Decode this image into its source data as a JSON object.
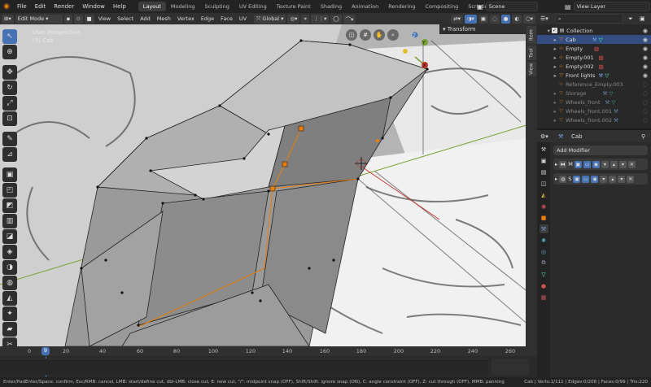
{
  "topbar": {
    "menus": [
      "File",
      "Edit",
      "Render",
      "Window",
      "Help"
    ],
    "workspaces": [
      "Layout",
      "Modeling",
      "Sculpting",
      "UV Editing",
      "Texture Paint",
      "Shading",
      "Animation",
      "Rendering",
      "Compositing",
      "Scripting"
    ],
    "active_workspace": "Layout",
    "add_workspace": "+",
    "scene": "Scene",
    "view_layer": "View Layer"
  },
  "header": {
    "mode": "Edit Mode",
    "menus": [
      "View",
      "Select",
      "Add",
      "Mesh",
      "Vertex",
      "Edge",
      "Face",
      "UV"
    ],
    "orientation": "Global"
  },
  "viewport": {
    "view_label": "User Perspective",
    "object_label": "(9) Cab",
    "gizmo_axes": [
      "Y",
      "Z",
      "X"
    ]
  },
  "npanel": {
    "title": "Transform",
    "tabs": [
      "Item",
      "Tool",
      "View"
    ]
  },
  "timeline": {
    "ticks": [
      "0",
      "9",
      "20",
      "40",
      "60",
      "80",
      "100",
      "120",
      "140",
      "160",
      "180",
      "200",
      "220",
      "240",
      "260"
    ],
    "current_frame": "9"
  },
  "status": {
    "hint": "Enter/PadEnter/Space: confirm, Esc/RMB: cancel, LMB: start/define cut, dbl-LMB: close cut, E: new cut, \"/\": midpoint snap (OFF), Shift/Shift: ignore snap (ON), C: angle constraint (OFF), Z: cut through (OFF), MMB: panning",
    "stats": "Cab | Verts:1/111 | Edges:0/208 | Faces:0/99 | Tris:220"
  },
  "outliner": {
    "collection": "Collection",
    "items": [
      {
        "name": "Cab",
        "selected": true,
        "dim": false
      },
      {
        "name": "Empty",
        "selected": false,
        "dim": false
      },
      {
        "name": "Empty.001",
        "selected": false,
        "dim": false
      },
      {
        "name": "Empty.002",
        "selected": false,
        "dim": false
      },
      {
        "name": "Front lights",
        "selected": false,
        "dim": false
      },
      {
        "name": "Reference_Empty.003",
        "selected": false,
        "dim": true
      },
      {
        "name": "Storage",
        "selected": false,
        "dim": true
      },
      {
        "name": "Wheels_front",
        "selected": false,
        "dim": true
      },
      {
        "name": "Wheels_front.001",
        "selected": false,
        "dim": true
      },
      {
        "name": "Wheels_front.002",
        "selected": false,
        "dim": true
      }
    ]
  },
  "properties": {
    "object_name": "Cab",
    "add_modifier": "Add Modifier",
    "modifiers": [
      {
        "letter": "M"
      },
      {
        "letter": "S"
      }
    ]
  },
  "colors": {
    "accent": "#4772b3",
    "orange": "#e87d0d",
    "mesh": "#8c8c8c"
  }
}
